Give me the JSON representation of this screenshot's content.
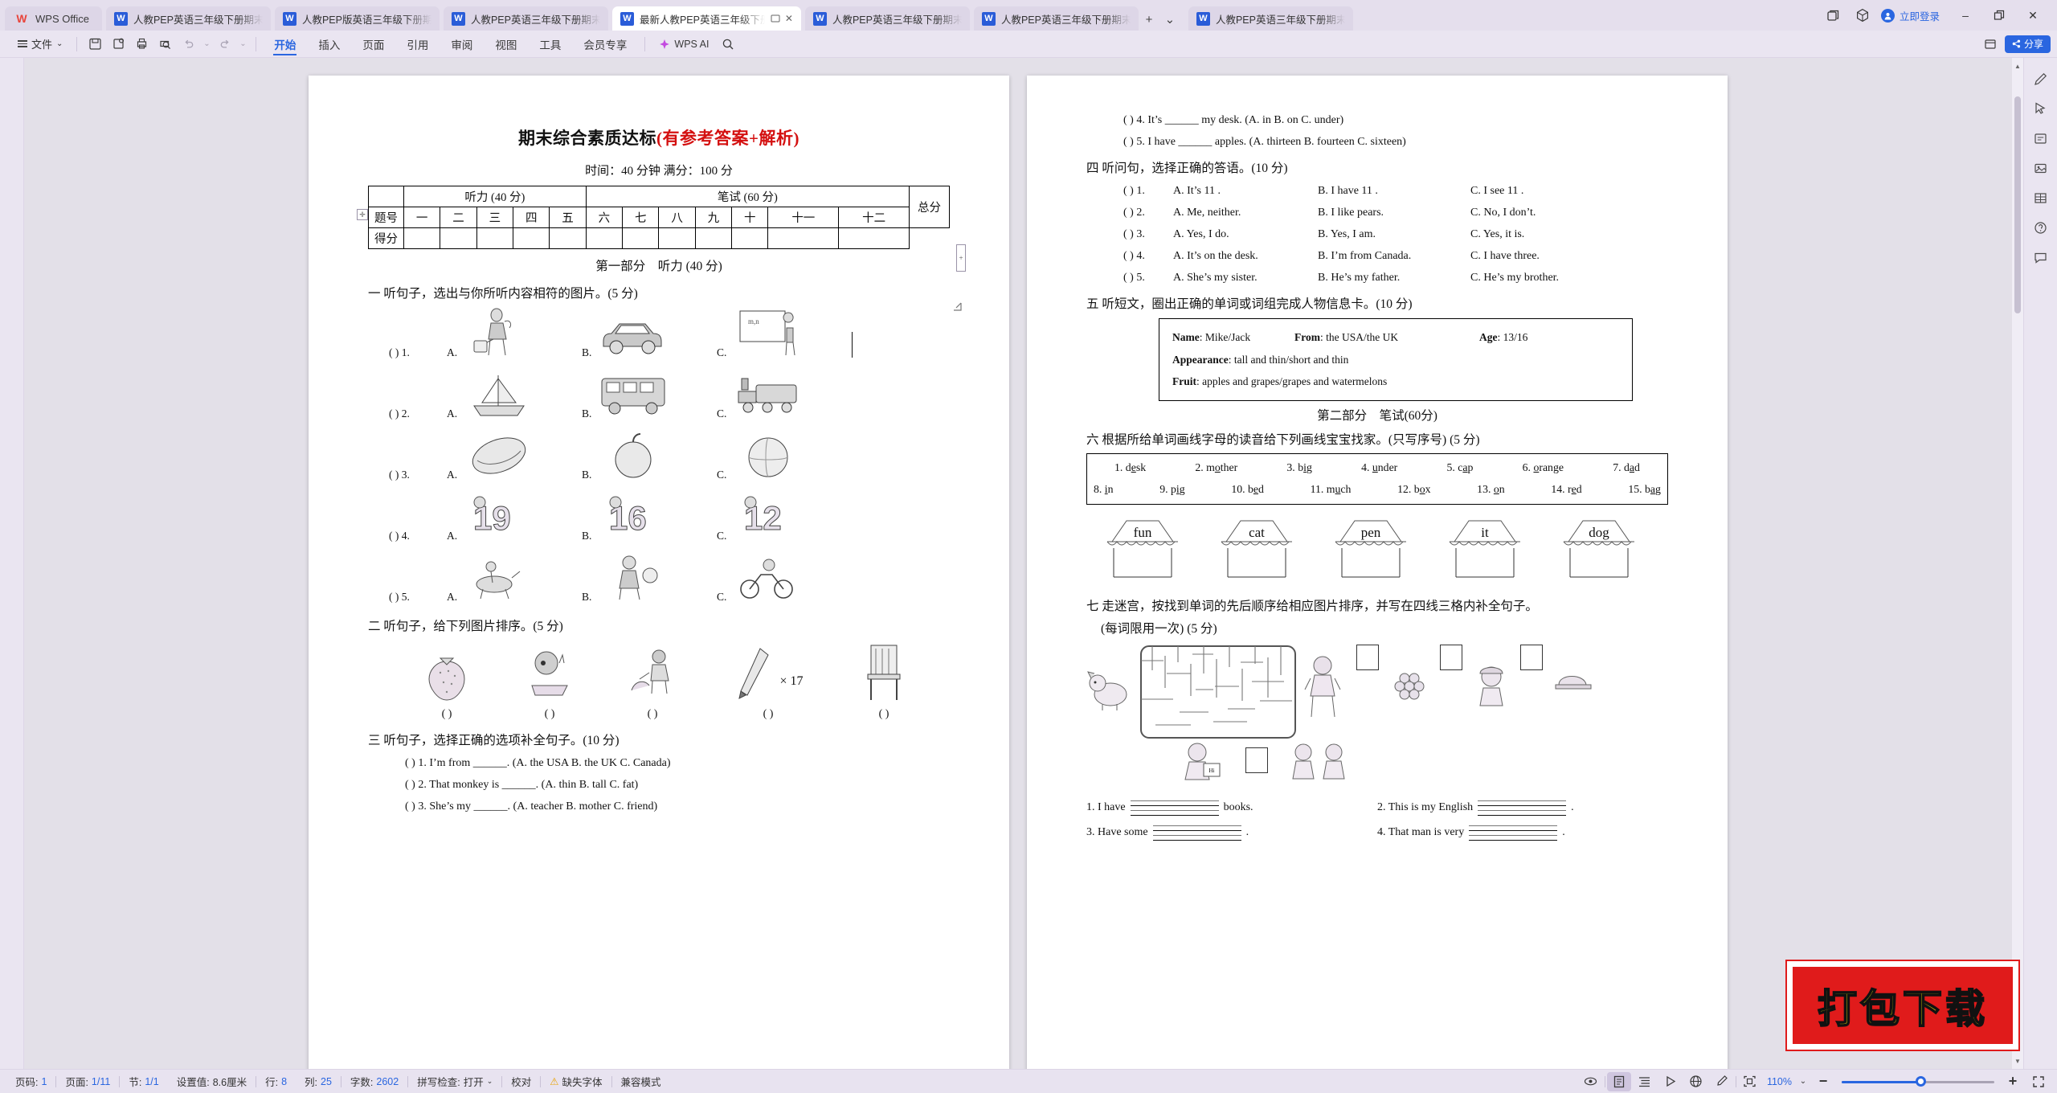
{
  "app": {
    "name": "WPS Office",
    "login_label": "立即登录"
  },
  "tabs": [
    {
      "label": "人教PEP英语三年级下册期末综合素质",
      "active": false
    },
    {
      "label": "人教PEP版英语三年级下册期末基础达",
      "active": false
    },
    {
      "label": "人教PEP英语三年级下册期末真题汇编",
      "active": false
    },
    {
      "label": "最新人教PEP英语三年级下册期",
      "active": true
    },
    {
      "label": "人教PEP英语三年级下册期末真题汇编",
      "active": false
    },
    {
      "label": "人教PEP英语三年级下册期末综合素质",
      "active": false
    },
    {
      "label": "人教PEP英语三年级下册期末能力训练",
      "active": false
    }
  ],
  "tabbar": {
    "new_tab": "+",
    "tab_list": "⌄"
  },
  "ribbon": {
    "file_menu": "文件",
    "tabs": [
      {
        "label": "开始",
        "active": true
      },
      {
        "label": "插入",
        "active": false
      },
      {
        "label": "页面",
        "active": false
      },
      {
        "label": "引用",
        "active": false
      },
      {
        "label": "审阅",
        "active": false
      },
      {
        "label": "视图",
        "active": false
      },
      {
        "label": "工具",
        "active": false
      },
      {
        "label": "会员专享",
        "active": false
      }
    ],
    "ai_label": "WPS AI",
    "share_label": "分享"
  },
  "statusbar": {
    "page_no": {
      "label": "页码:",
      "value": "1"
    },
    "page_of": {
      "label": "页面:",
      "value": "1/11"
    },
    "section": {
      "label": "节:",
      "value": "1/1"
    },
    "setting": {
      "label": "设置值:",
      "value": "8.6厘米"
    },
    "row": {
      "label": "行:",
      "value": "8"
    },
    "col": {
      "label": "列:",
      "value": "25"
    },
    "words": {
      "label": "字数:",
      "value": "2602"
    },
    "spellcheck": {
      "label": "拼写检查:",
      "value": "打开"
    },
    "proof": "校对",
    "missing_font": "缺失字体",
    "compat_mode": "兼容模式",
    "zoom": "110%"
  },
  "watermark": {
    "text": "打包下载"
  },
  "document": {
    "left_page": {
      "title_black": "期末综合素质达标",
      "title_red": "(有参考答案+解析)",
      "subtitle": "时间：40 分钟   满分：100 分",
      "score_table": {
        "header": [
          "",
          "听力 (40 分)",
          "笔试 (60 分)",
          "总分"
        ],
        "row_label_1": "题号",
        "row_label_2": "得分",
        "numbers": [
          "一",
          "二",
          "三",
          "四",
          "五",
          "六",
          "七",
          "八",
          "九",
          "十",
          "十一",
          "十二"
        ]
      },
      "part_one": "第一部分　听力 (40 分)",
      "section_1": "一 听句子，选出与你所听内容相符的图片。(5 分)",
      "pic_rows": [
        {
          "lead": "(     ) 1.",
          "opts": [
            "A.",
            "B.",
            "C."
          ],
          "icons": [
            "man-watering-icon",
            "car-icon",
            "teacher-board-icon"
          ]
        },
        {
          "lead": "(     ) 2.",
          "opts": [
            "A.",
            "B.",
            "C."
          ],
          "icons": [
            "boat-icon",
            "bus-icon",
            "train-icon"
          ]
        },
        {
          "lead": "(     ) 3.",
          "opts": [
            "A.",
            "B.",
            "C."
          ],
          "icons": [
            "watermelon-icon",
            "apple-icon",
            "orange-icon"
          ]
        },
        {
          "lead": "(     ) 4.",
          "opts": [
            "A.",
            "B.",
            "C."
          ],
          "icons": [
            "number-19-icon",
            "number-16-icon",
            "number-12-icon"
          ]
        },
        {
          "lead": "(     ) 5.",
          "opts": [
            "A.",
            "B.",
            "C."
          ],
          "icons": [
            "riding-horse-icon",
            "kid-ball-icon",
            "kid-bike-icon"
          ]
        }
      ],
      "section_2": "二 听句子，给下列图片排序。(5 分)",
      "order_items": [
        {
          "icon": "strawberry-icon",
          "paren": "(        )",
          "label": ""
        },
        {
          "icon": "boy-reading-icon",
          "paren": "(        )",
          "label": ""
        },
        {
          "icon": "watering-flowers-icon",
          "paren": "(        )",
          "label": ""
        },
        {
          "icon": "pen-icon",
          "paren": "(        )",
          "label": "× 17"
        },
        {
          "icon": "chair-icon",
          "paren": "(        )",
          "label": ""
        }
      ],
      "section_3": "三 听句子，选择正确的选项补全句子。(10 分)",
      "q3": [
        "(     ) 1. I’m from ______. (A. the USA B. the UK C. Canada)",
        "(     ) 2. That monkey is ______. (A. thin B. tall C. fat)",
        "(     ) 3. She’s my ______. (A. teacher B. mother C. friend)"
      ]
    },
    "right_page": {
      "q3_cont": [
        "(     ) 4. It’s ______ my desk. (A. in B. on C. under)",
        "(     ) 5. I have ______ apples. (A. thirteen B. fourteen C. sixteen)"
      ],
      "section_4": "四 听问句，选择正确的答语。(10 分)",
      "q4": [
        {
          "lead": "(     ) 1.",
          "a": "A. It’s 11 .",
          "b": "B. I have 11 .",
          "c": "C. I see 11 ."
        },
        {
          "lead": "(     ) 2.",
          "a": "A. Me, neither.",
          "b": "B. I like pears.",
          "c": "C. No, I don’t."
        },
        {
          "lead": "(     ) 3.",
          "a": "A. Yes, I do.",
          "b": "B. Yes, I am.",
          "c": "C. Yes, it is."
        },
        {
          "lead": "(     ) 4.",
          "a": "A. It’s on the desk.",
          "b": "B. I’m from Canada.",
          "c": "C. I have three."
        },
        {
          "lead": "(     ) 5.",
          "a": "A. She’s my sister.",
          "b": "B. He’s my father.",
          "c": "C. He’s my brother."
        }
      ],
      "section_5": "五 听短文，圈出正确的单词或词组完成人物信息卡。(10 分)",
      "info_card": [
        {
          "k1": "Name",
          "v1": "Mike/Jack",
          "k2": "From",
          "v2": "the USA/the UK",
          "k3": "Age",
          "v3": "13/16"
        },
        {
          "k1": "Appearance",
          "v1": "tall and thin/short and thin"
        },
        {
          "k1": "Fruit",
          "v1": "apples and grapes/grapes and watermelons"
        }
      ],
      "part_two": "第二部分　笔试(60分)",
      "section_6": "六 根据所给单词画线字母的读音给下列画线宝宝找家。(只写序号) (5 分)",
      "word_bank_row1": [
        "1. d<u>e</u>sk",
        "2. m<u>o</u>ther",
        "3. b<u>i</u>g",
        "4. <u>u</u>nder",
        "5. c<u>a</u>p",
        "6. <u>o</u>range",
        "7. d<u>a</u>d"
      ],
      "word_bank_row2": [
        "8. <u>i</u>n",
        "9. p<u>i</u>g",
        "10. b<u>e</u>d",
        "11. m<u>u</u>ch",
        "12. b<u>o</u>x",
        "13. <u>o</u>n",
        "14. r<u>e</u>d",
        "15. b<u>a</u>g"
      ],
      "houses": [
        "fun",
        "cat",
        "pen",
        "it",
        "dog"
      ],
      "section_7_line1": "七 走迷宫，按找到单词的先后顺序给相应图片排序，并写在四线三格内补全句子。",
      "section_7_line2": "(每词限用一次) (5 分)",
      "maze_sentences": [
        {
          "pre": "1. I have",
          "post": "books."
        },
        {
          "pre": "2. This is my English",
          "post": "."
        },
        {
          "pre": "3. Have some",
          "post": "."
        },
        {
          "pre": "4. That man is very",
          "post": "."
        }
      ]
    }
  }
}
